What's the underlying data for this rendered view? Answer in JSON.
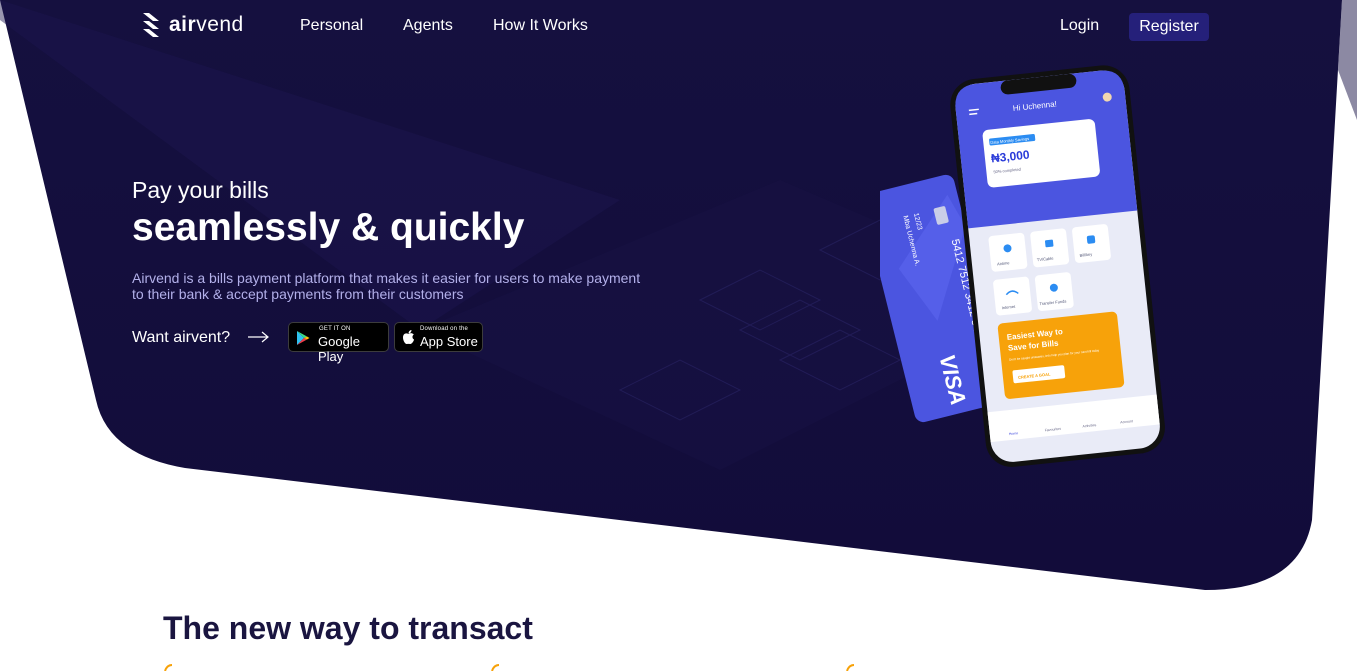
{
  "brand": {
    "name_bold": "air",
    "name_light": "vend",
    "colors": {
      "hero_background": "#140e42",
      "register_button": "#25207a",
      "app_primary": "#4b55e0",
      "promo_orange": "#f7a20a",
      "title_text": "#1a1540"
    }
  },
  "nav": {
    "links": [
      "Personal",
      "Agents",
      "How It Works"
    ],
    "login": "Login",
    "register": "Register"
  },
  "hero": {
    "line1": "Pay your bills",
    "line2": "seamlessly & quickly",
    "description": "Airvend is a bills payment platform that makes it easier for users to make payment to their bank & accept payments from their customers",
    "cta_text": "Want airvent?",
    "cta_icon": "arrow-right-icon",
    "google_play": {
      "small": "GET IT ON",
      "big": "Google Play",
      "icon": "play-triangle-icon"
    },
    "app_store": {
      "small": "Download on the",
      "big": "App Store",
      "icon": "apple-icon"
    }
  },
  "phone_mockup": {
    "greeting": "Hi Uchenna!",
    "savings_badge": "Data Monthly Savings",
    "savings_amount": "₦3,000",
    "savings_note": "50% completed",
    "services": [
      "Airtime",
      "TV/Cable",
      "Bill/key",
      "Internet",
      "Transfer Funds"
    ],
    "promo_title_1": "Easiest Way to",
    "promo_title_2": "Save for Bills",
    "promo_body": "Don't be caught unawares, let's help you plan for your next bill today",
    "promo_button": "CREATE A GOAL",
    "tabs": [
      "Home",
      "Favourites",
      "Activities",
      "Account"
    ]
  },
  "card_mockup": {
    "number": "5412 7512 3412 3456",
    "expiry": "12/23",
    "holder": "Mba Uchenna A.",
    "network": "VISA"
  },
  "section": {
    "title": "The new way to transact"
  }
}
